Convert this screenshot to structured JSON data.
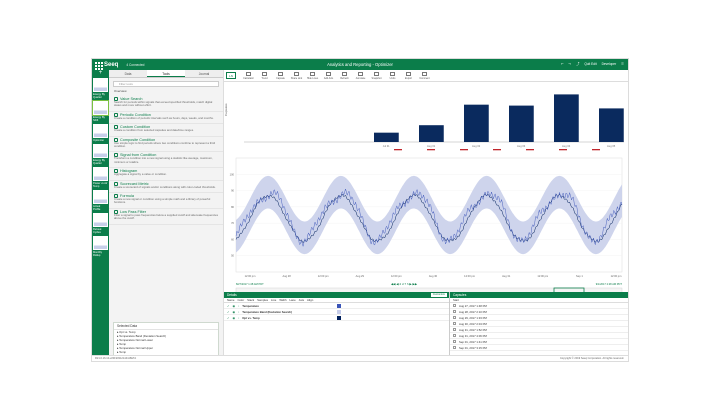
{
  "topbar": {
    "brand": "Seeq",
    "connection": "4 Connected",
    "title": "Analytics and Reporting - Optimizer",
    "user": "Developer",
    "edit_label": "Quit Edit"
  },
  "worksheets": [
    {
      "label": "Energy By Quarter"
    },
    {
      "label": "Energy By Shift"
    },
    {
      "label": "Optimizer"
    },
    {
      "label": "Energy By Quarter"
    },
    {
      "label": "Power vs Air Temp"
    },
    {
      "label": "Actual Profile"
    },
    {
      "label": "Reheat Cycles"
    },
    {
      "label": "Monthly Rollup"
    }
  ],
  "panel": {
    "tabs": [
      "Data",
      "Tools",
      "Journal"
    ],
    "filter_placeholder": "Filter tools",
    "overview": "Overview",
    "tools": [
      {
        "name": "Value Search",
        "desc": "Search for periods within signals that exceed specified thresholds, match digital states and more without effort."
      },
      {
        "name": "Periodic Condition",
        "desc": "Create a condition of periodic intervals such as hours, days, weeks, and months."
      },
      {
        "name": "Custom Condition",
        "desc": "Create a condition from selected capsules and date/time ranges."
      },
      {
        "name": "Composite Condition",
        "desc": "Use simple logic to find periods where two conditions combine to represent a third condition."
      },
      {
        "name": "Signal from Condition",
        "desc": "Transform a condition into a new signal using a statistic like average, maximum, minimum or totalize."
      },
      {
        "name": "Histogram",
        "desc": "Aggregate a signal by a value or condition."
      },
      {
        "name": "Scorecard Metric",
        "desc": "Create a scorecard of signals and/or conditions along with color-coded thresholds."
      },
      {
        "name": "Formula",
        "desc": "Create a new signal or condition using a simple math and a library of powerful functions."
      },
      {
        "name": "Low Pass Filter",
        "desc": "Filter a signal to pass frequencies below a supplied cutoff and attenuate frequencies above the cutoff."
      }
    ],
    "data_items": {
      "header": "Selected Data",
      "items": [
        "Opt vs. Temp",
        "Temperature Band (Deviation Search)",
        "Temperature Normal Lower",
        "Temp",
        "Temperature Normal Upper",
        "Temp"
      ]
    }
  },
  "toolbar": {
    "view": "LN",
    "buttons": [
      "Calculator",
      "Trend",
      "Capsule",
      "Share Link",
      "Hide Lines",
      "Add Axis",
      "Refresh",
      "Annotate",
      "Snapshot",
      "Undo",
      "Export",
      "Comment"
    ]
  },
  "chart_data": [
    {
      "type": "bar",
      "title": "",
      "ylabel": "Capsules",
      "series": [
        {
          "name": "Temperature",
          "values": [
            1.0,
            1.8,
            4.0,
            3.9,
            5.1,
            3.6
          ]
        }
      ],
      "categories": [
        "Jul 31",
        "Aug 01",
        "Aug 02",
        "Aug 03",
        "Aug 04",
        "Aug 05"
      ],
      "ylim": [
        0,
        6
      ]
    },
    {
      "type": "line",
      "title": "",
      "x_ticks": [
        "12:00 pm",
        "Aug 28",
        "12:00 pm",
        "Aug 29",
        "12:00 pm",
        "Aug 30",
        "12:00 pm",
        "Aug 31",
        "12:00 pm",
        "Sep 1",
        "12:00 pm"
      ],
      "ylim": [
        40,
        110
      ],
      "y_ticks": [
        100,
        90,
        80,
        70,
        60,
        50
      ],
      "series": [
        {
          "name": "Temperature",
          "color": "#3b55b8"
        },
        {
          "name": "Temperature Band (Deviation Search)",
          "color": "#c6cce9"
        },
        {
          "name": "Opt vs. Temp",
          "color": "#001f5b"
        }
      ],
      "band_period_hours": 24,
      "temperature_range": [
        58,
        92
      ]
    }
  ],
  "timebar": {
    "start": "8/27/2017 1:48 AM PDT",
    "end": "9/1/2017 2:28 AM PDT",
    "zoom": "4 d 7 h",
    "range_start": "Aug 28 2017",
    "range_end": "Sep 2017",
    "left_label": "2/6/2017",
    "right_label": "2 months",
    "date_right": "Now"
  },
  "details": {
    "title": "Details",
    "customize": "Customize",
    "columns": [
      "Name",
      "Color",
      "Stack",
      "Samples",
      "Line",
      "Width",
      "Lane",
      "Axis",
      "Align"
    ],
    "rows": [
      {
        "name": "Temperature",
        "color": "#3b55b8"
      },
      {
        "name": "Temperature Band (Deviation Search)",
        "color": "#c6cce9"
      },
      {
        "name": "Opt vs. Temp",
        "color": "#001f5b"
      }
    ]
  },
  "capsules": {
    "title": "Capsules",
    "header": "Start",
    "rows": [
      "Aug 27, 2017 1:48 PM",
      "Aug 28, 2017 2:10 PM",
      "Aug 29, 2017 1:33 PM",
      "Aug 30, 2017 2:04 PM",
      "Aug 31, 2017 1:52 PM",
      "Aug 31, 2017 4:06 PM",
      "Sep 01, 2017 1:41 PM",
      "Sep 01, 2017 3:15 PM"
    ]
  },
  "bottom": {
    "left": "R21.0.16.10-v201903121444-BETA",
    "right": "Copyright © 2019 Seeq Corporation. All rights reserved."
  }
}
